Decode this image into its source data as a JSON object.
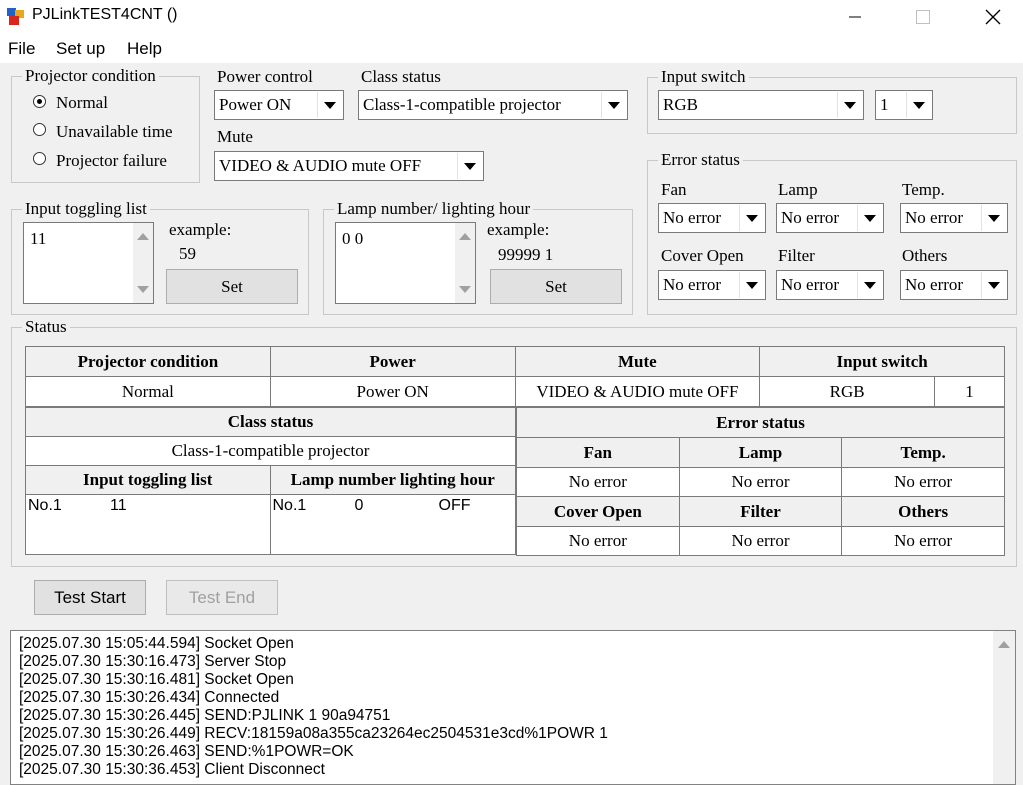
{
  "window": {
    "title": "PJLinkTEST4CNT ()"
  },
  "menu": [
    "File",
    "Set up",
    "Help"
  ],
  "projector_condition": {
    "legend": "Projector condition",
    "options": [
      "Normal",
      "Unavailable time",
      "Projector failure"
    ],
    "selected": "Normal"
  },
  "power_control": {
    "label": "Power control",
    "value": "Power ON"
  },
  "class_status": {
    "label": "Class status",
    "value": "Class-1-compatible projector"
  },
  "mute": {
    "label": "Mute",
    "value": "VIDEO & AUDIO mute OFF"
  },
  "input_switch": {
    "legend": "Input switch",
    "value": "RGB",
    "number": "1"
  },
  "error_status": {
    "legend": "Error status",
    "fan": {
      "label": "Fan",
      "value": "No error"
    },
    "lamp": {
      "label": "Lamp",
      "value": "No error"
    },
    "temp": {
      "label": "Temp.",
      "value": "No error"
    },
    "cover_open": {
      "label": "Cover Open",
      "value": "No error"
    },
    "filter": {
      "label": "Filter",
      "value": "No error"
    },
    "others": {
      "label": "Others",
      "value": "No error"
    }
  },
  "input_toggling": {
    "legend": "Input toggling list",
    "value": "11",
    "example_label": "example:",
    "example_value": "59",
    "set_label": "Set"
  },
  "lamp_hour": {
    "legend": "Lamp number/ lighting hour",
    "value": "0 0",
    "example_label": "example:",
    "example_value": "99999 1",
    "set_label": "Set"
  },
  "status": {
    "legend": "Status",
    "headers": {
      "projector_condition": "Projector condition",
      "power": "Power",
      "mute": "Mute",
      "input_switch": "Input switch",
      "class_status": "Class status",
      "error_status": "Error status",
      "fan": "Fan",
      "lamp": "Lamp",
      "temp": "Temp.",
      "input_toggling_list": "Input toggling list",
      "lamp_number_hour": "Lamp number lighting hour",
      "cover_open": "Cover Open",
      "filter": "Filter",
      "others": "Others"
    },
    "values": {
      "projector_condition": "Normal",
      "power": "Power ON",
      "mute": "VIDEO & AUDIO mute OFF",
      "input_switch": "RGB",
      "input_number": "1",
      "class_status": "Class-1-compatible projector",
      "fan": "No error",
      "lamp": "No error",
      "temp": "No error",
      "cover_open": "No error",
      "filter": "No error",
      "others": "No error",
      "toggle_no": "No.1",
      "toggle_val": "11",
      "lamp_no": "No.1",
      "lamp_hour": "0",
      "lamp_state": "OFF"
    }
  },
  "buttons": {
    "test_start": "Test Start",
    "test_end": "Test End"
  },
  "log": [
    "[2025.07.30  15:05:44.594] Socket Open",
    "[2025.07.30  15:30:16.473] Server Stop",
    "[2025.07.30  15:30:16.481] Socket Open",
    "[2025.07.30  15:30:26.434] Connected",
    "[2025.07.30  15:30:26.445] SEND:PJLINK 1 90a94751",
    "[2025.07.30  15:30:26.449] RECV:18159a08a355ca23264ec2504531e3cd%1POWR 1",
    "[2025.07.30  15:30:26.463] SEND:%1POWR=OK",
    "[2025.07.30  15:30:36.453] Client Disconnect"
  ]
}
